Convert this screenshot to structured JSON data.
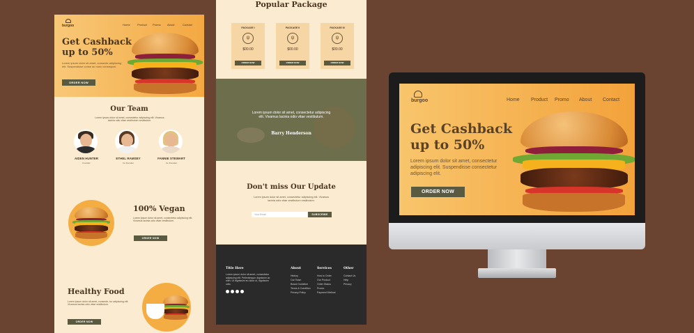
{
  "brand": "burgoo",
  "nav": [
    "Home",
    "Product",
    "Promo",
    "About",
    "Contact"
  ],
  "hero": {
    "title_line1": "Get Cashback",
    "title_line2": "up to 50%",
    "body": "Lorem ipsum dolor sit amet, consectetur adipiscing elit. Suspendisse consectetur adipiscing elit.",
    "body_short": "Lorem ipsum dolor sit amet, consecte adipiscing elit. Suspendisse conse ac nunc consequat.",
    "cta": "ORDER NOW"
  },
  "team": {
    "title": "Our Team",
    "intro": "Lorem ipsum dolor sit amet, consectetur adipiscing elit. Vivamus lacinia odio vitae vestibulum vestibulum.",
    "members": [
      {
        "name": "AIDEN HUNTER",
        "role": "Founder"
      },
      {
        "name": "ETHEL RAMSEY",
        "role": "Co Founder"
      },
      {
        "name": "FANNIE STEWART",
        "role": "Co Founder"
      }
    ]
  },
  "vegan": {
    "title": "100% Vegan",
    "body": "Lorem ipsum dolor sit amet, consectetur adipiscing elit. Vivamus lacinia odio vitae vestibulum.",
    "cta": "ORDER NOW"
  },
  "healthy": {
    "title": "Healthy Food",
    "body": "Lorem ipsum dolor sit amet, consecte- tur adipiscing elit. Vivamus lacinia odio vitae vestibulum.",
    "cta": "ORDER NOW"
  },
  "packages": {
    "title": "Popular Package",
    "items": [
      {
        "name": "PACKAGE I",
        "price": "$00.00",
        "cta": "ORDER NOW"
      },
      {
        "name": "PACKAGE II",
        "price": "$00.00",
        "cta": "ORDER NOW"
      },
      {
        "name": "PACKAGE III",
        "price": "$00.00",
        "cta": "ORDER NOW"
      }
    ]
  },
  "testimonial": {
    "quote": "Lorem ipsum dolor sit amet, consectetur adipiscing elit. Vivamus lacinia odio vitae vestibulum.",
    "author": "Barry Henderson"
  },
  "newsletter": {
    "title": "Don't miss Our Update",
    "body": "Lorem ipsum dolor sit amet, consectetur adipiscing elit. Vivamus lacinia odio vitae vestibulum vestibulum.",
    "placeholder": "Your Email",
    "cta": "SUBSCRIBE"
  },
  "footer": {
    "title": "Title Here",
    "desc": "Lorem ipsum dolor sit amet, consectetur adipiscing elit. Pellentesque dignissim ac nibh. Ut dignissim eu dolor ut, dignissim odio.",
    "cols": [
      {
        "title": "About",
        "links": [
          "History",
          "Our Team",
          "Brand Guideline",
          "Terms & Condition",
          "Privacy Policy"
        ]
      },
      {
        "title": "Services",
        "links": [
          "How to Order",
          "Our Product",
          "Order Status",
          "Promo",
          "Payment Method"
        ]
      },
      {
        "title": "Other",
        "links": [
          "Contact Us",
          "Help",
          "Privacy"
        ]
      }
    ]
  },
  "colors": {
    "background": "#6a4430",
    "cream": "#fbecd1",
    "orange": "#f4a842",
    "olive": "#5a5a40",
    "dark": "#2a2a2a"
  }
}
